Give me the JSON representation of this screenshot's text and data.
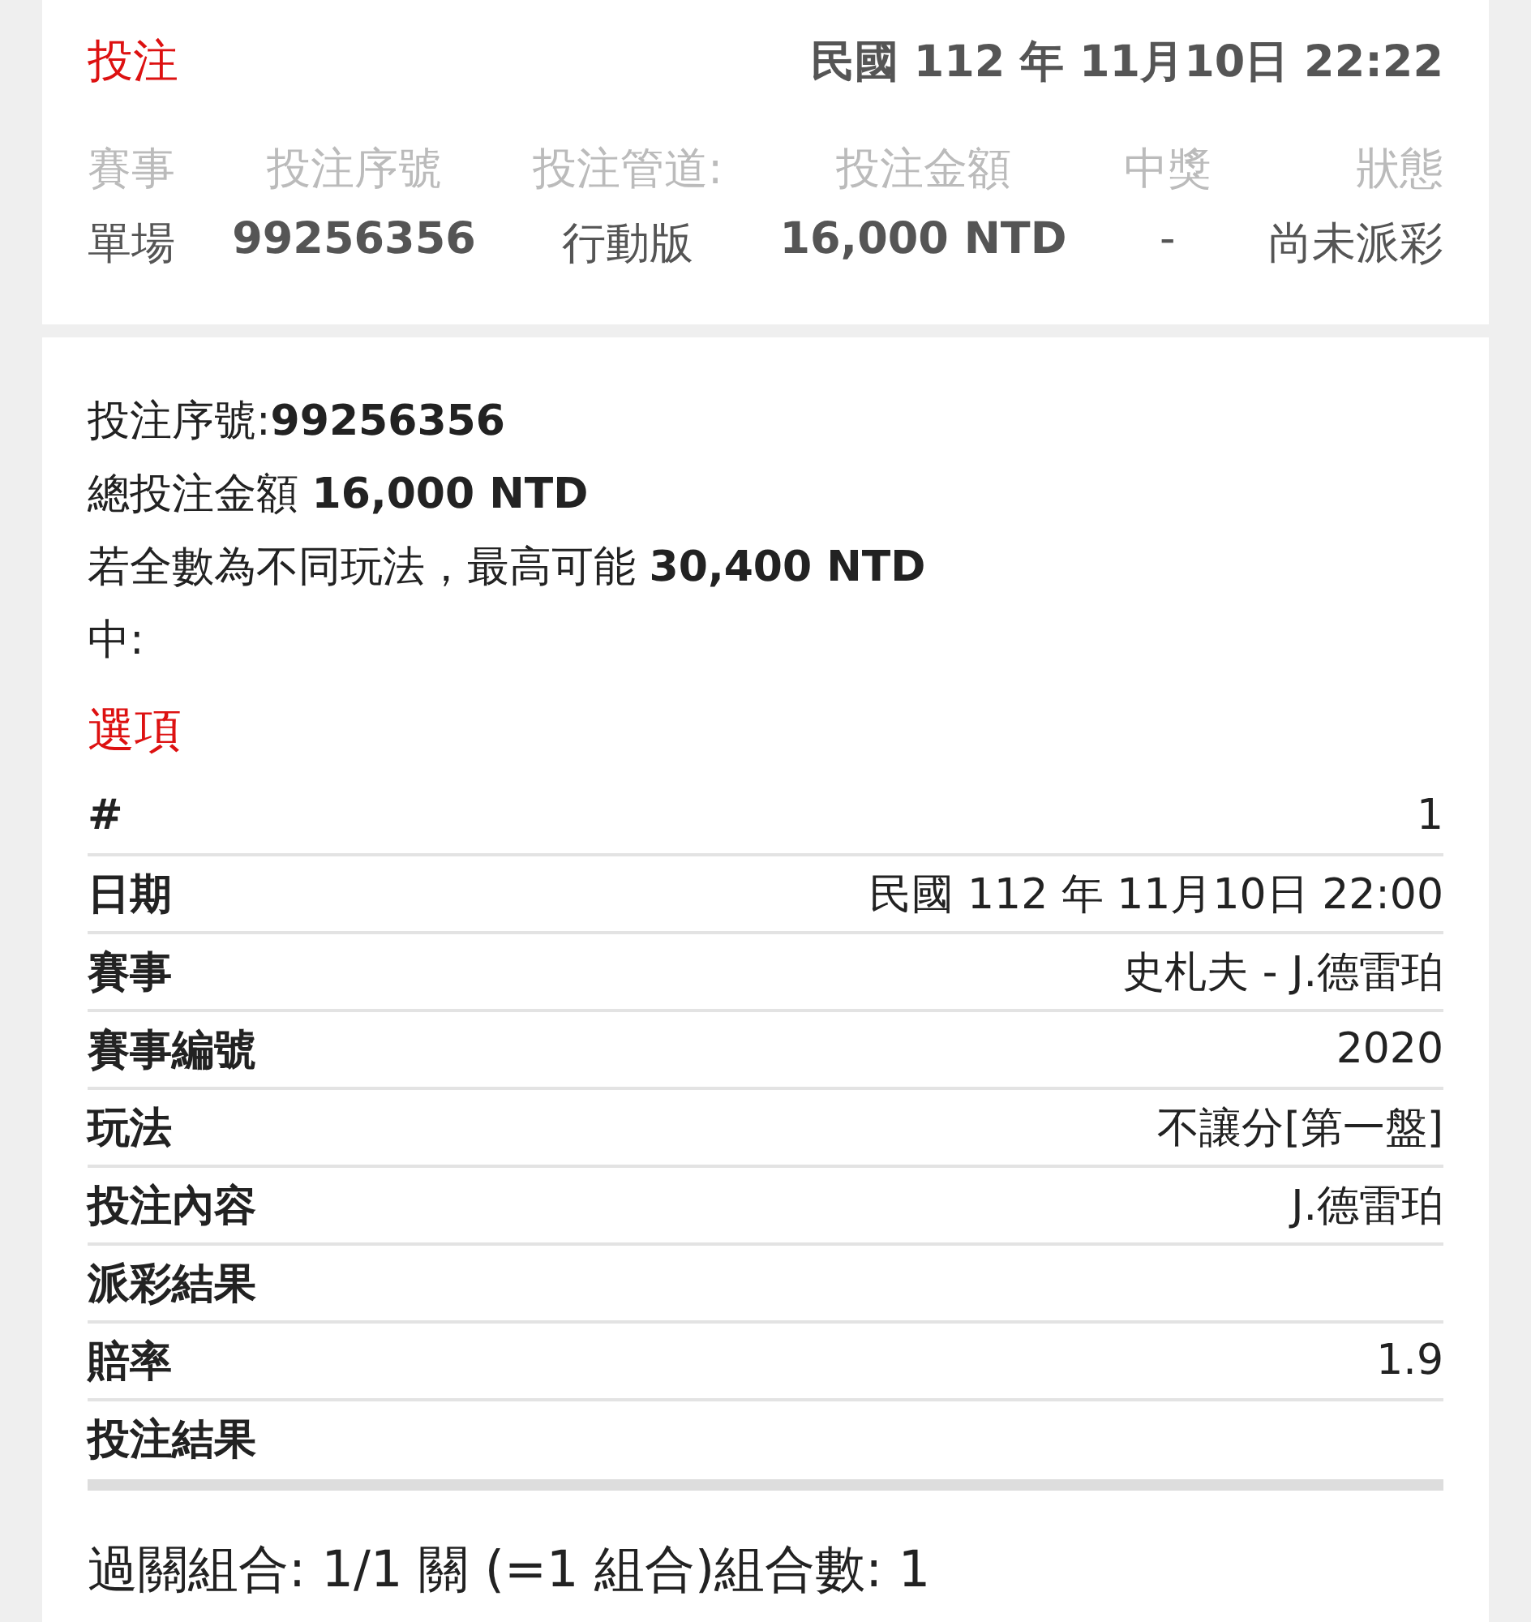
{
  "header": {
    "title": "投注",
    "datetime": "民國 112 年 11月10日 22:22"
  },
  "summary_columns": [
    {
      "label": "賽事",
      "value": "單場",
      "kind": "text"
    },
    {
      "label": "投注序號",
      "value": "99256356",
      "kind": "number"
    },
    {
      "label": "投注管道:",
      "value": "行動版",
      "kind": "text"
    },
    {
      "label": "投注金額",
      "value": "16,000 NTD",
      "kind": "number"
    },
    {
      "label": "中獎",
      "value": "-",
      "kind": "text"
    },
    {
      "label": "狀態",
      "value": "尚未派彩",
      "kind": "text"
    }
  ],
  "details": [
    "投注序號:**99256356**",
    "總投注金額 **16,000 NTD**",
    "若全數為不同玩法，最高可能 **30,400 NTD**",
    "中:"
  ],
  "options_title": "選項",
  "options_table": [
    {
      "label": "#",
      "value": "1"
    },
    {
      "label": "日期",
      "value": "民國 112 年 11月10日 22:00"
    },
    {
      "label": "賽事",
      "value": "史札夫 - J.德雷珀"
    },
    {
      "label": "賽事編號",
      "value": "2020"
    },
    {
      "label": "玩法",
      "value": "不讓分[第一盤]"
    },
    {
      "label": "投注內容",
      "value": "J.德雷珀"
    },
    {
      "label": "派彩結果"
    },
    {
      "label": "賠率",
      "value": "1.9"
    },
    {
      "label": "投注結果"
    }
  ],
  "combination": "過關組合: 1/1 關 (=1 組合)組合數: 1"
}
